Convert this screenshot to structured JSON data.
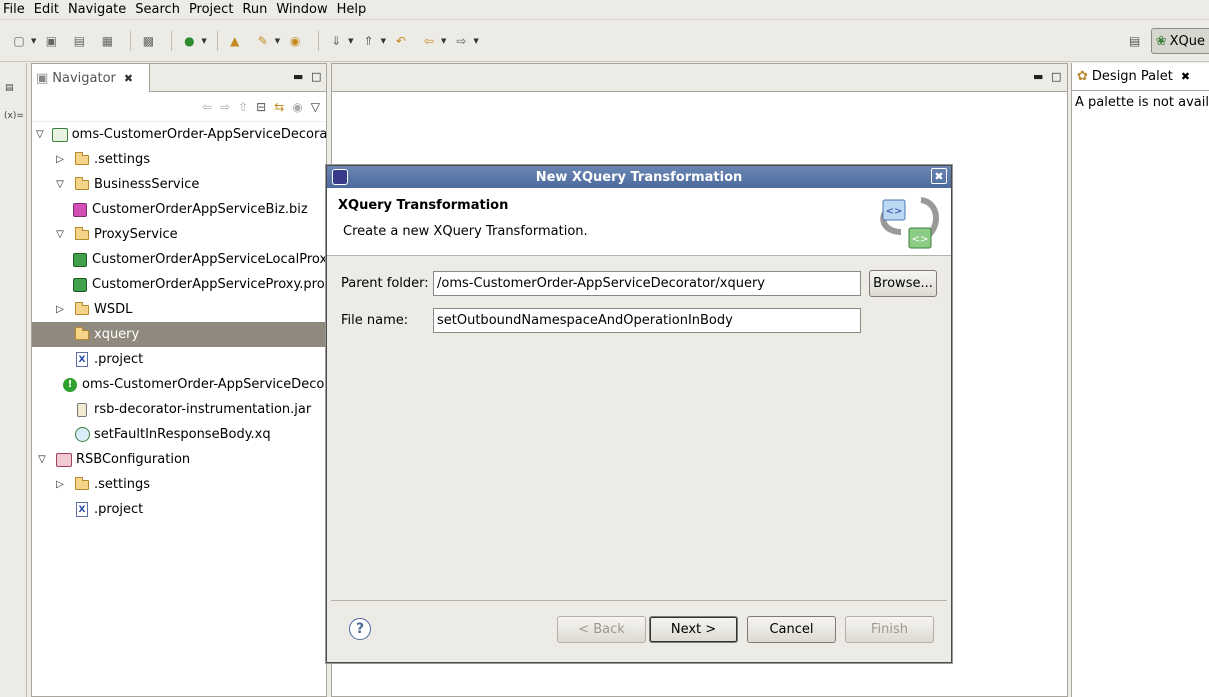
{
  "menu": [
    "File",
    "Edit",
    "Navigate",
    "Search",
    "Project",
    "Run",
    "Window",
    "Help"
  ],
  "perspective": {
    "label": "XQue"
  },
  "navigator": {
    "tab_label": "Navigator",
    "tree": [
      {
        "label": "oms-CustomerOrder-AppServiceDecorator",
        "depth": 0,
        "twisty": "open",
        "icon": "project"
      },
      {
        "label": ".settings",
        "depth": 1,
        "twisty": "closed",
        "icon": "folder"
      },
      {
        "label": "BusinessService",
        "depth": 1,
        "twisty": "open",
        "icon": "folder"
      },
      {
        "label": "CustomerOrderAppServiceBiz.biz",
        "depth": 2,
        "twisty": "none",
        "icon": "biz"
      },
      {
        "label": "ProxyService",
        "depth": 1,
        "twisty": "open",
        "icon": "folder"
      },
      {
        "label": "CustomerOrderAppServiceLocalProxy.proxy",
        "depth": 2,
        "twisty": "none",
        "icon": "proxy"
      },
      {
        "label": "CustomerOrderAppServiceProxy.proxy",
        "depth": 2,
        "twisty": "none",
        "icon": "proxy"
      },
      {
        "label": "WSDL",
        "depth": 1,
        "twisty": "closed",
        "icon": "folder"
      },
      {
        "label": "xquery",
        "depth": 1,
        "twisty": "none",
        "icon": "folder",
        "selected": true
      },
      {
        "label": ".project",
        "depth": 1,
        "twisty": "none",
        "icon": "xfile"
      },
      {
        "label": "oms-CustomerOrder-AppServiceDecorator",
        "depth": 1,
        "twisty": "none",
        "icon": "warn"
      },
      {
        "label": "rsb-decorator-instrumentation.jar",
        "depth": 1,
        "twisty": "none",
        "icon": "jar"
      },
      {
        "label": "setFaultInResponseBody.xq",
        "depth": 1,
        "twisty": "none",
        "icon": "xq"
      },
      {
        "label": "RSBConfiguration",
        "depth": 0,
        "twisty": "open",
        "icon": "rsb"
      },
      {
        "label": ".settings",
        "depth": 1,
        "twisty": "closed",
        "icon": "folder"
      },
      {
        "label": ".project",
        "depth": 1,
        "twisty": "none",
        "icon": "xfile"
      }
    ]
  },
  "palette": {
    "tab_label": "Design Palet",
    "message": "A palette is not availa"
  },
  "dialog": {
    "title": "New XQuery Transformation",
    "header_title": "XQuery Transformation",
    "header_desc": "Create a new XQuery Transformation.",
    "parent_folder_label": "Parent folder:",
    "parent_folder_value": "/oms-CustomerOrder-AppServiceDecorator/xquery",
    "browse_label": "Browse...",
    "file_name_label": "File name:",
    "file_name_value": "setOutboundNamespaceAndOperationInBody",
    "back_label": "< Back",
    "next_label": "Next >",
    "cancel_label": "Cancel",
    "finish_label": "Finish"
  },
  "colors": {
    "selection": "#8f8a7d",
    "title_bar": "#4c6a9d"
  }
}
